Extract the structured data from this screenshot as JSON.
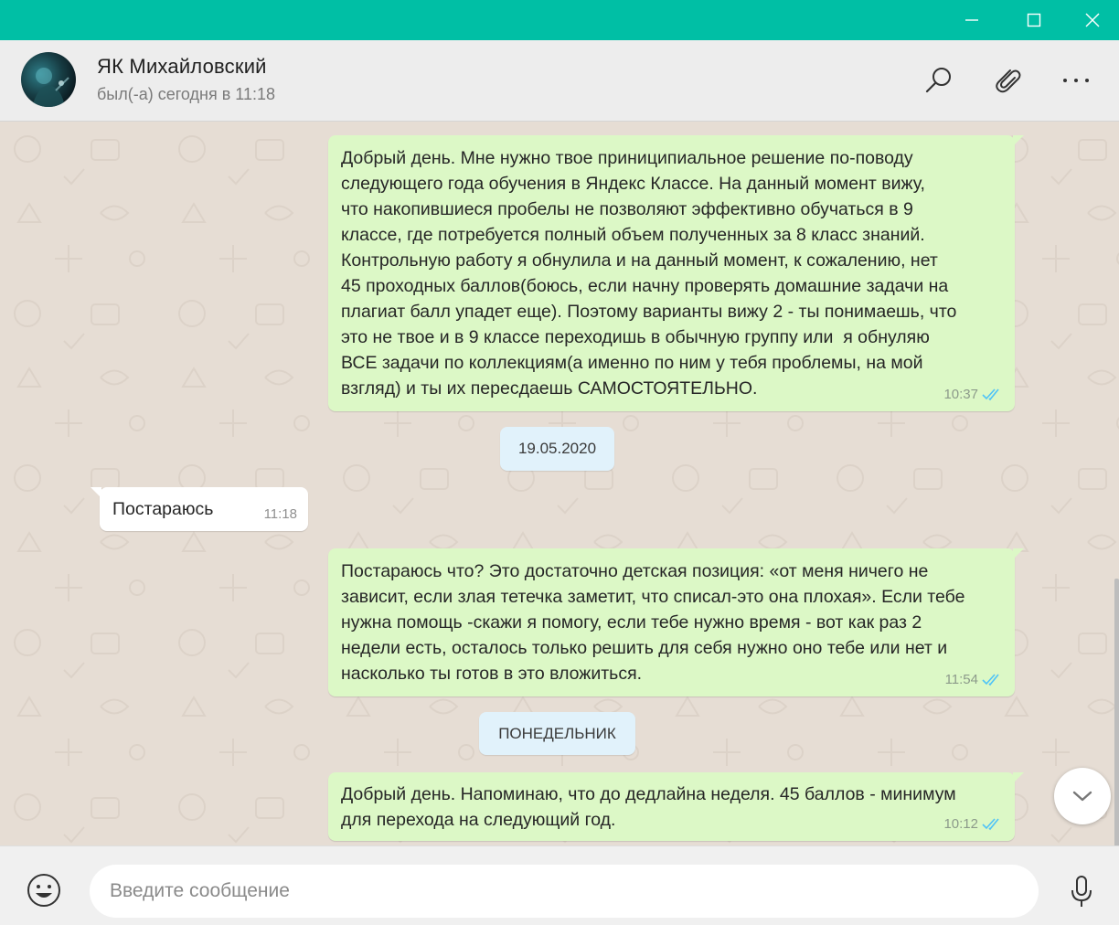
{
  "window": {
    "controls": {
      "minimize": "minimize-icon",
      "maximize": "maximize-icon",
      "close": "close-icon"
    },
    "accent_color": "#00bfa5"
  },
  "header": {
    "contact_name": "ЯК Михайловский",
    "status": "был(-а) сегодня в 11:18",
    "icons": [
      "search-icon",
      "paperclip-icon",
      "more-icon"
    ]
  },
  "messages": [
    {
      "direction": "out",
      "text": "Добрый день. Мне нужно твое приниципиальное решение по-поводу\nследующего года обучения в Яндекс Классе. На данный момент вижу,\nчто накопившиеся пробелы не позволяют эффективно обучаться в 9\nклассе, где потребуется полный объем полученных за 8 класс знаний.\nКонтрольную работу я обнулила и на данный момент, к сожалению, нет\n45 проходных баллов(боюсь, если начну проверять домашние задачи на\nплагиат балл упадет еще). Поэтому варианты вижу 2 - ты понимаешь, что\nэто не твое и в 9 классе переходишь в обычную группу или  я обнуляю\nВСЕ задачи по коллекциям(а именно по ним у тебя проблемы, на мой\nвзгляд) и ты их пересдаешь САМОСТОЯТЕЛЬНО.",
      "time": "10:37",
      "status": "read"
    },
    {
      "direction": "date",
      "text": "19.05.2020"
    },
    {
      "direction": "in",
      "text": "Постараюсь",
      "time": "11:18"
    },
    {
      "direction": "out",
      "text": "Постараюсь что? Это достаточно детская позиция: «от меня ничего не\nзависит, если злая тетечка заметит, что списал-это она плохая». Если тебе\nнужна помощь -скажи я помогу, если тебе нужно время - вот как раз 2\nнедели есть, осталось только решить для себя нужно оно тебе или нет и\nнасколько ты готов в это вложиться.",
      "time": "11:54",
      "status": "read"
    },
    {
      "direction": "date",
      "text": "ПОНЕДЕЛЬНИК"
    },
    {
      "direction": "out",
      "text": "Добрый день. Напоминаю, что до дедлайна неделя. 45 баллов - минимум\nдля перехода на следующий год.",
      "time": "10:12",
      "status": "read"
    }
  ],
  "composer": {
    "placeholder": "Введите сообщение",
    "value": "",
    "icons": [
      "emoji-icon",
      "microphone-icon"
    ]
  },
  "scroll_down_icon": "chevron-down-icon",
  "colors": {
    "outgoing_bubble": "#dcf8c6",
    "incoming_bubble": "#ffffff",
    "date_chip": "#e1f2fb",
    "read_ticks": "#4fc3f7"
  }
}
